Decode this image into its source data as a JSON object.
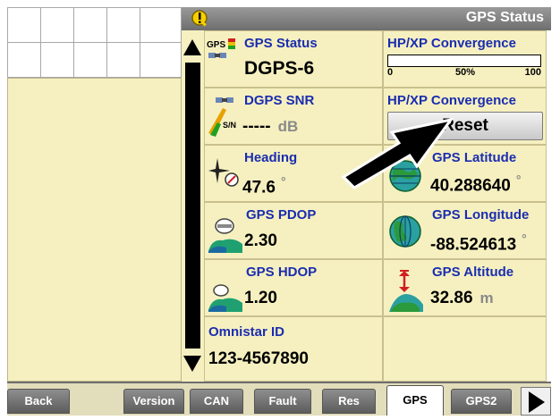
{
  "header": {
    "title": "GPS Status"
  },
  "cells": {
    "gps_status": {
      "title": "GPS Status",
      "value": "DGPS-6",
      "icon_label": "GPS"
    },
    "convergence_bar": {
      "title": "HP/XP Convergence",
      "progress_percent": 0,
      "tick_min": "0",
      "tick_mid": "50%",
      "tick_max": "100"
    },
    "dgps_snr": {
      "title": "DGPS SNR",
      "value": "-----",
      "unit": "dB",
      "icon_label": "S/N"
    },
    "convergence_reset": {
      "title": "HP/XP Convergence",
      "button_label": "Reset"
    },
    "heading": {
      "title": "Heading",
      "value": "47.6",
      "unit": "°"
    },
    "gps_latitude": {
      "title": "GPS Latitude",
      "value": "40.288640",
      "unit": "°"
    },
    "gps_pdop": {
      "title": "GPS PDOP",
      "value": "2.30"
    },
    "gps_longitude": {
      "title": "GPS Longitude",
      "value": "-88.524613",
      "unit": "°"
    },
    "gps_hdop": {
      "title": "GPS HDOP",
      "value": "1.20"
    },
    "gps_altitude": {
      "title": "GPS Altitude",
      "value": "32.86",
      "unit": "m"
    },
    "omnistar_id": {
      "title": "Omnistar ID",
      "value": "123-4567890"
    }
  },
  "tabs": [
    {
      "label": "Back"
    },
    {
      "label": "Version"
    },
    {
      "label": "CAN"
    },
    {
      "label": "Fault"
    },
    {
      "label": "Res"
    },
    {
      "label": "GPS",
      "active": true
    },
    {
      "label": "GPS2"
    }
  ],
  "icons": {
    "warning": "warning-icon",
    "scroll_up": "scroll-up-arrow-icon",
    "scroll_down": "scroll-down-arrow-icon",
    "next": "next-page-arrow-icon",
    "pointer": "pointer-arrow-icon"
  },
  "colors": {
    "panel_bg": "#f6f0c0",
    "title_blue": "#1a2db0",
    "header_gray": "#7a7a7a"
  }
}
